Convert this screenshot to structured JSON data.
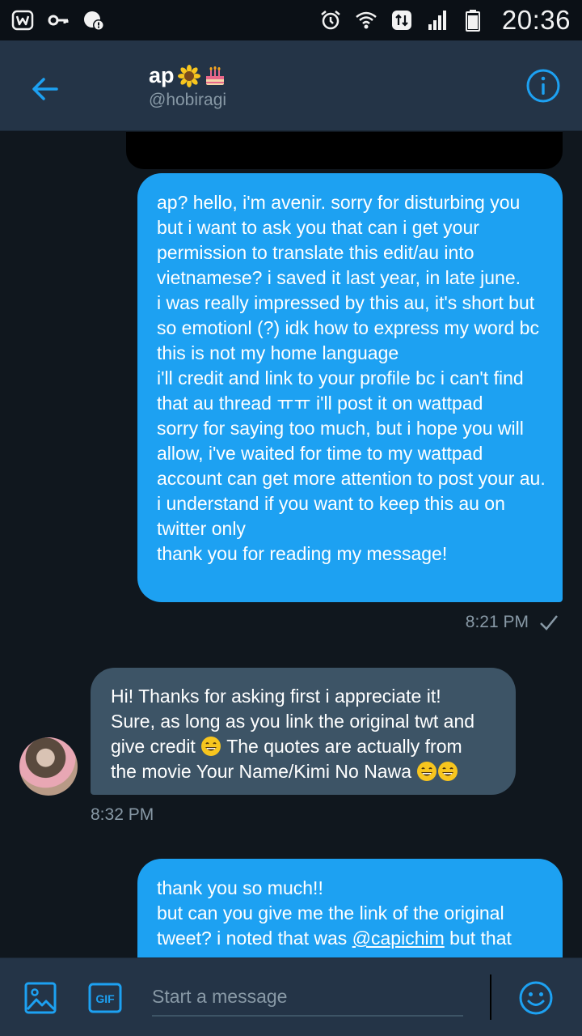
{
  "status_bar": {
    "time": "20:36",
    "icons": [
      "wattpad-icon",
      "key-icon",
      "notification-icon",
      "alarm-icon",
      "wifi-icon",
      "data-icon",
      "signal-icon",
      "battery-icon"
    ]
  },
  "header": {
    "name": "ap",
    "name_emojis": [
      "sunflower-emoji",
      "birthday-cake-emoji"
    ],
    "handle": "@hobiragi"
  },
  "conversation": {
    "messages": [
      {
        "direction": "outgoing",
        "text": "ap? hello, i'm avenir. sorry for disturbing you but i want to ask you that can i get your permission to translate this edit/au into vietnamese? i saved it last year, in late june.\ni was really impressed by this au, it's short but so emotionl (?) idk how to express my word bc this is not my home language\ni'll credit and link to your profile bc i can't find that au thread ㅠㅠ i'll post it on wattpad\nsorry for saying too much, but i hope you will allow, i've waited for time to my wattpad account can get more attention to post your au.\ni understand if you want to keep this au on twitter only\nthank you for reading my message!",
        "time": "8:21 PM"
      },
      {
        "direction": "incoming",
        "part1": "Hi! Thanks for asking first i appreciate it!\nSure, as long as you link the original twt and give credit ",
        "part2": " The quotes are actually from the movie Your Name/Kimi No Nawa ",
        "emoji": "grinning-face-emoji",
        "time": "8:32 PM"
      },
      {
        "direction": "outgoing",
        "part1": "thank you so much!!\nbut can you give me the link of the original tweet? i noted that was ",
        "mention": "@capichim",
        "part2": " but that"
      }
    ]
  },
  "composer": {
    "placeholder": "Start a message"
  },
  "colors": {
    "background": "#10171e",
    "header": "#243447",
    "outgoing_bubble": "#1da1f2",
    "incoming_bubble": "#3d5466",
    "accent": "#1da1f2",
    "secondary_text": "#8899a6"
  }
}
